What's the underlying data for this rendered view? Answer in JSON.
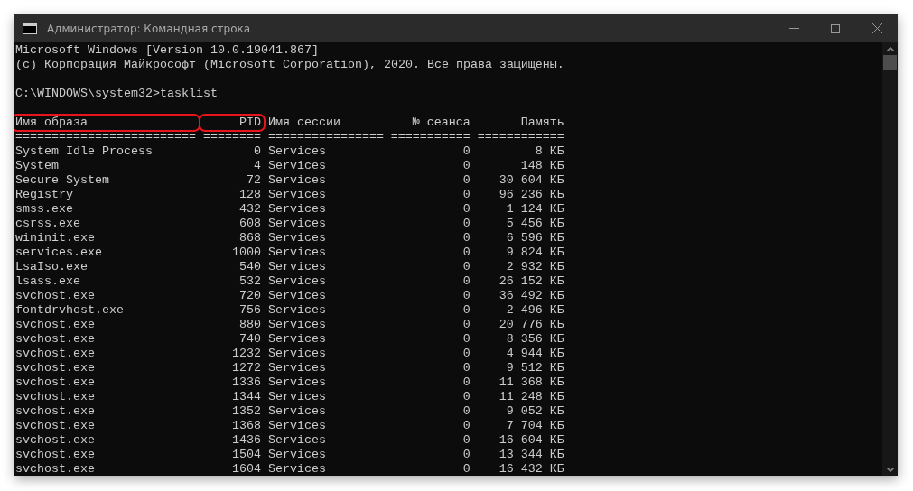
{
  "window": {
    "title": "Администратор: Командная строка"
  },
  "console": {
    "banner": [
      "Microsoft Windows [Version 10.0.19041.867]",
      "(c) Корпорация Майкрософт (Microsoft Corporation), 2020. Все права защищены."
    ],
    "prompt": "C:\\WINDOWS\\system32>tasklist",
    "columns": [
      {
        "label": "Имя образа",
        "highlighted": true,
        "separator": "========================="
      },
      {
        "label": "PID",
        "highlighted": true,
        "separator": "========"
      },
      {
        "label": "Имя сессии",
        "highlighted": false,
        "separator": "================"
      },
      {
        "label": "№ сеанса",
        "highlighted": false,
        "separator": "==========="
      },
      {
        "label": "Память",
        "highlighted": false,
        "separator": "============"
      }
    ],
    "rows": [
      [
        "System Idle Process",
        "0",
        "Services",
        "0",
        "8 КБ"
      ],
      [
        "System",
        "4",
        "Services",
        "0",
        "148 КБ"
      ],
      [
        "Secure System",
        "72",
        "Services",
        "0",
        "30 604 КБ"
      ],
      [
        "Registry",
        "128",
        "Services",
        "0",
        "96 236 КБ"
      ],
      [
        "smss.exe",
        "432",
        "Services",
        "0",
        "1 124 КБ"
      ],
      [
        "csrss.exe",
        "608",
        "Services",
        "0",
        "5 456 КБ"
      ],
      [
        "wininit.exe",
        "868",
        "Services",
        "0",
        "6 596 КБ"
      ],
      [
        "services.exe",
        "1000",
        "Services",
        "0",
        "9 824 КБ"
      ],
      [
        "LsaIso.exe",
        "540",
        "Services",
        "0",
        "2 932 КБ"
      ],
      [
        "lsass.exe",
        "532",
        "Services",
        "0",
        "26 152 КБ"
      ],
      [
        "svchost.exe",
        "720",
        "Services",
        "0",
        "36 492 КБ"
      ],
      [
        "fontdrvhost.exe",
        "756",
        "Services",
        "0",
        "2 496 КБ"
      ],
      [
        "svchost.exe",
        "880",
        "Services",
        "0",
        "20 776 КБ"
      ],
      [
        "svchost.exe",
        "740",
        "Services",
        "0",
        "8 356 КБ"
      ],
      [
        "svchost.exe",
        "1232",
        "Services",
        "0",
        "4 944 КБ"
      ],
      [
        "svchost.exe",
        "1272",
        "Services",
        "0",
        "9 512 КБ"
      ],
      [
        "svchost.exe",
        "1336",
        "Services",
        "0",
        "11 368 КБ"
      ],
      [
        "svchost.exe",
        "1344",
        "Services",
        "0",
        "11 248 КБ"
      ],
      [
        "svchost.exe",
        "1352",
        "Services",
        "0",
        "9 052 КБ"
      ],
      [
        "svchost.exe",
        "1368",
        "Services",
        "0",
        "7 704 КБ"
      ],
      [
        "svchost.exe",
        "1436",
        "Services",
        "0",
        "16 604 КБ"
      ],
      [
        "svchost.exe",
        "1504",
        "Services",
        "0",
        "13 344 КБ"
      ],
      [
        "svchost.exe",
        "1604",
        "Services",
        "0",
        "16 432 КБ"
      ]
    ]
  }
}
